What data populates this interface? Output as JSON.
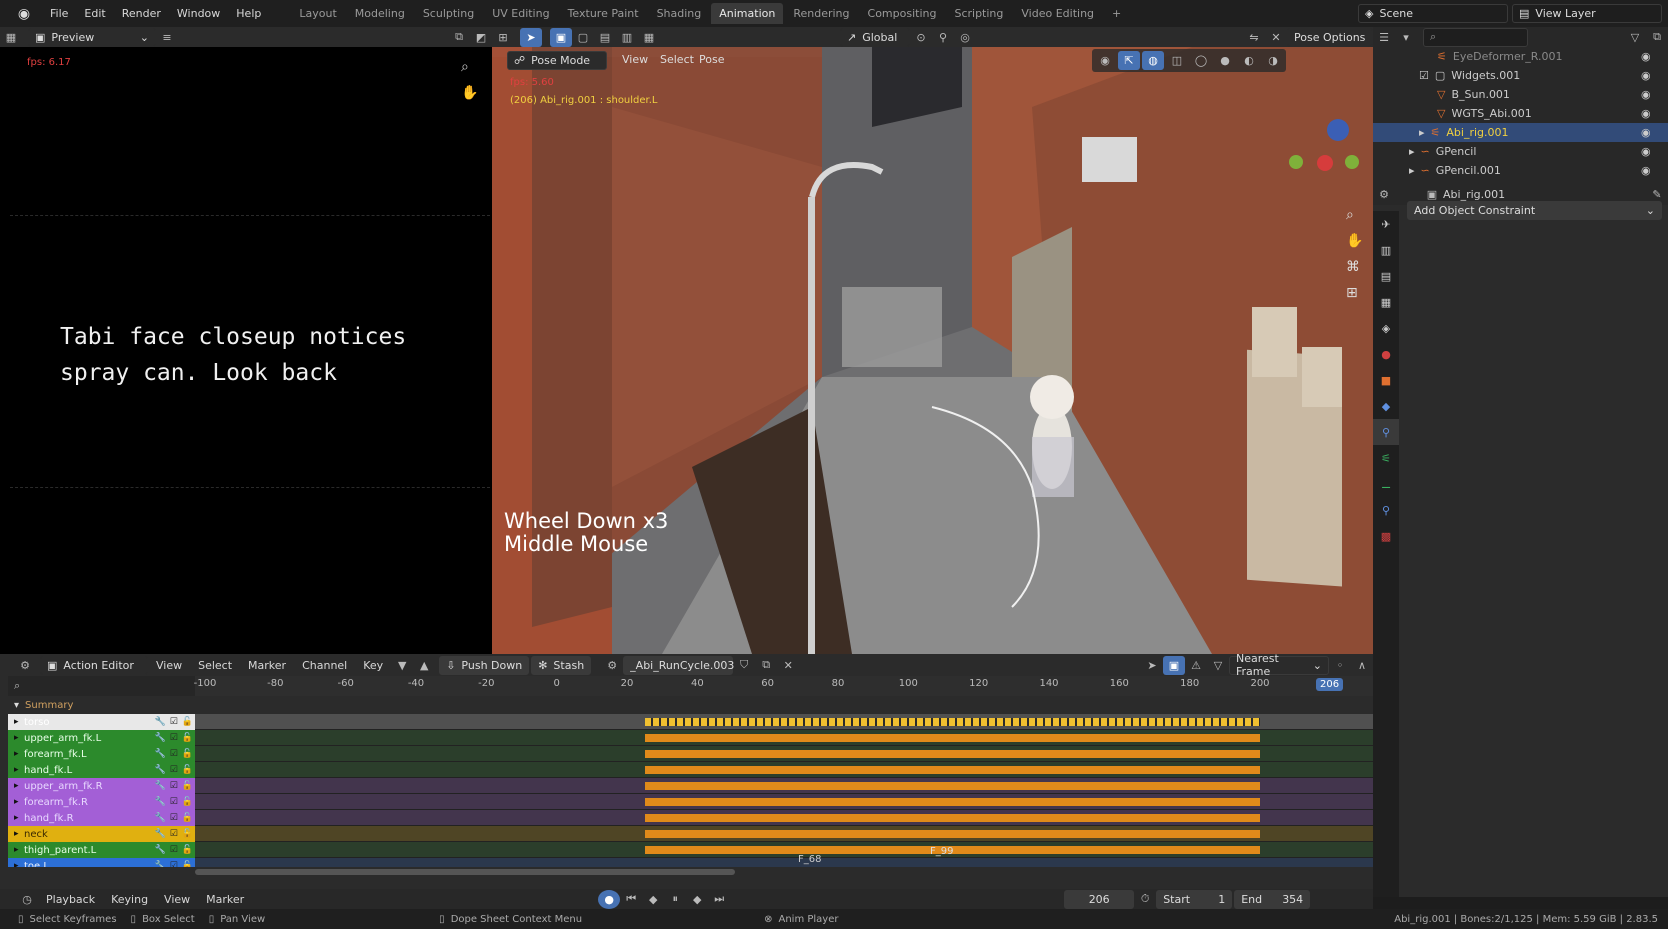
{
  "topbar": {
    "menus": [
      "File",
      "Edit",
      "Render",
      "Window",
      "Help"
    ],
    "workspaces": [
      "Layout",
      "Modeling",
      "Sculpting",
      "UV Editing",
      "Texture Paint",
      "Shading",
      "Animation",
      "Rendering",
      "Compositing",
      "Scripting",
      "Video Editing"
    ],
    "active_workspace": "Animation",
    "scene": "Scene",
    "view_layer": "View Layer"
  },
  "preview": {
    "mode": "Preview",
    "fps": "fps: 6.17",
    "note": "Tabi face closeup notices\nspray can. Look back"
  },
  "viewport": {
    "mode": "Pose Mode",
    "menus": [
      "View",
      "Select",
      "Pose"
    ],
    "transform": "Global",
    "pose_options": "Pose Options",
    "fps": "fps: 5.60",
    "object_info": "(206) Abi_rig.001 : shoulder.L",
    "keycast_line1": "Wheel Down x3",
    "keycast_line2": "Middle Mouse"
  },
  "outliner": {
    "items": [
      {
        "label": "EyeDeformer_R.001"
      },
      {
        "label": "Widgets.001"
      },
      {
        "label": "B_Sun.001"
      },
      {
        "label": "WGTS_Abi.001"
      },
      {
        "label": "Abi_rig.001"
      },
      {
        "label": "GPencil"
      },
      {
        "label": "GPencil.001"
      }
    ]
  },
  "properties": {
    "object_name": "Abi_rig.001",
    "add_constraint": "Add Object Constraint"
  },
  "dopesheet": {
    "editor": "Action Editor",
    "menus": [
      "View",
      "Select",
      "Marker",
      "Channel",
      "Key"
    ],
    "push_down": "Push Down",
    "stash": "Stash",
    "action": "_Abi_RunCycle.003",
    "snap": "Nearest Frame",
    "ruler": [
      "-100",
      "-80",
      "-60",
      "-40",
      "-20",
      "0",
      "20",
      "40",
      "60",
      "80",
      "100",
      "120",
      "140",
      "160",
      "180",
      "200"
    ],
    "current_frame": "206",
    "summary": "Summary",
    "channels": [
      {
        "label": "torso",
        "color": "#e8e8e8",
        "text": "#ffffff"
      },
      {
        "label": "upper_arm_fk.L",
        "color": "#2c8a2c",
        "text": "#e8ffe8"
      },
      {
        "label": "forearm_fk.L",
        "color": "#2c8a2c",
        "text": "#e8ffe8"
      },
      {
        "label": "hand_fk.L",
        "color": "#2c8a2c",
        "text": "#e8ffe8"
      },
      {
        "label": "upper_arm_fk.R",
        "color": "#a35fd6",
        "text": "#e8d8ff"
      },
      {
        "label": "forearm_fk.R",
        "color": "#a35fd6",
        "text": "#e8d8ff"
      },
      {
        "label": "hand_fk.R",
        "color": "#a35fd6",
        "text": "#e8d8ff"
      },
      {
        "label": "neck",
        "color": "#e0b010",
        "text": "#3a2a00"
      },
      {
        "label": "thigh_parent.L",
        "color": "#2c8a2c",
        "text": "#e8ffe8"
      },
      {
        "label": "toe.L",
        "color": "#2c6fd6",
        "text": "#e8f0ff"
      }
    ],
    "markers": [
      "F_68",
      "F_99"
    ]
  },
  "timeline": {
    "menus": [
      "Playback",
      "Keying",
      "View",
      "Marker"
    ],
    "frame": "206",
    "start_label": "Start",
    "start": "1",
    "end_label": "End",
    "end": "354"
  },
  "statusbar": {
    "hints": [
      "Select Keyframes",
      "Box Select",
      "Pan View",
      "Dope Sheet Context Menu"
    ],
    "anim_player": "Anim Player",
    "info": "Abi_rig.001 | Bones:2/1,125 | Mem: 5.59 GiB | 2.83.5"
  }
}
